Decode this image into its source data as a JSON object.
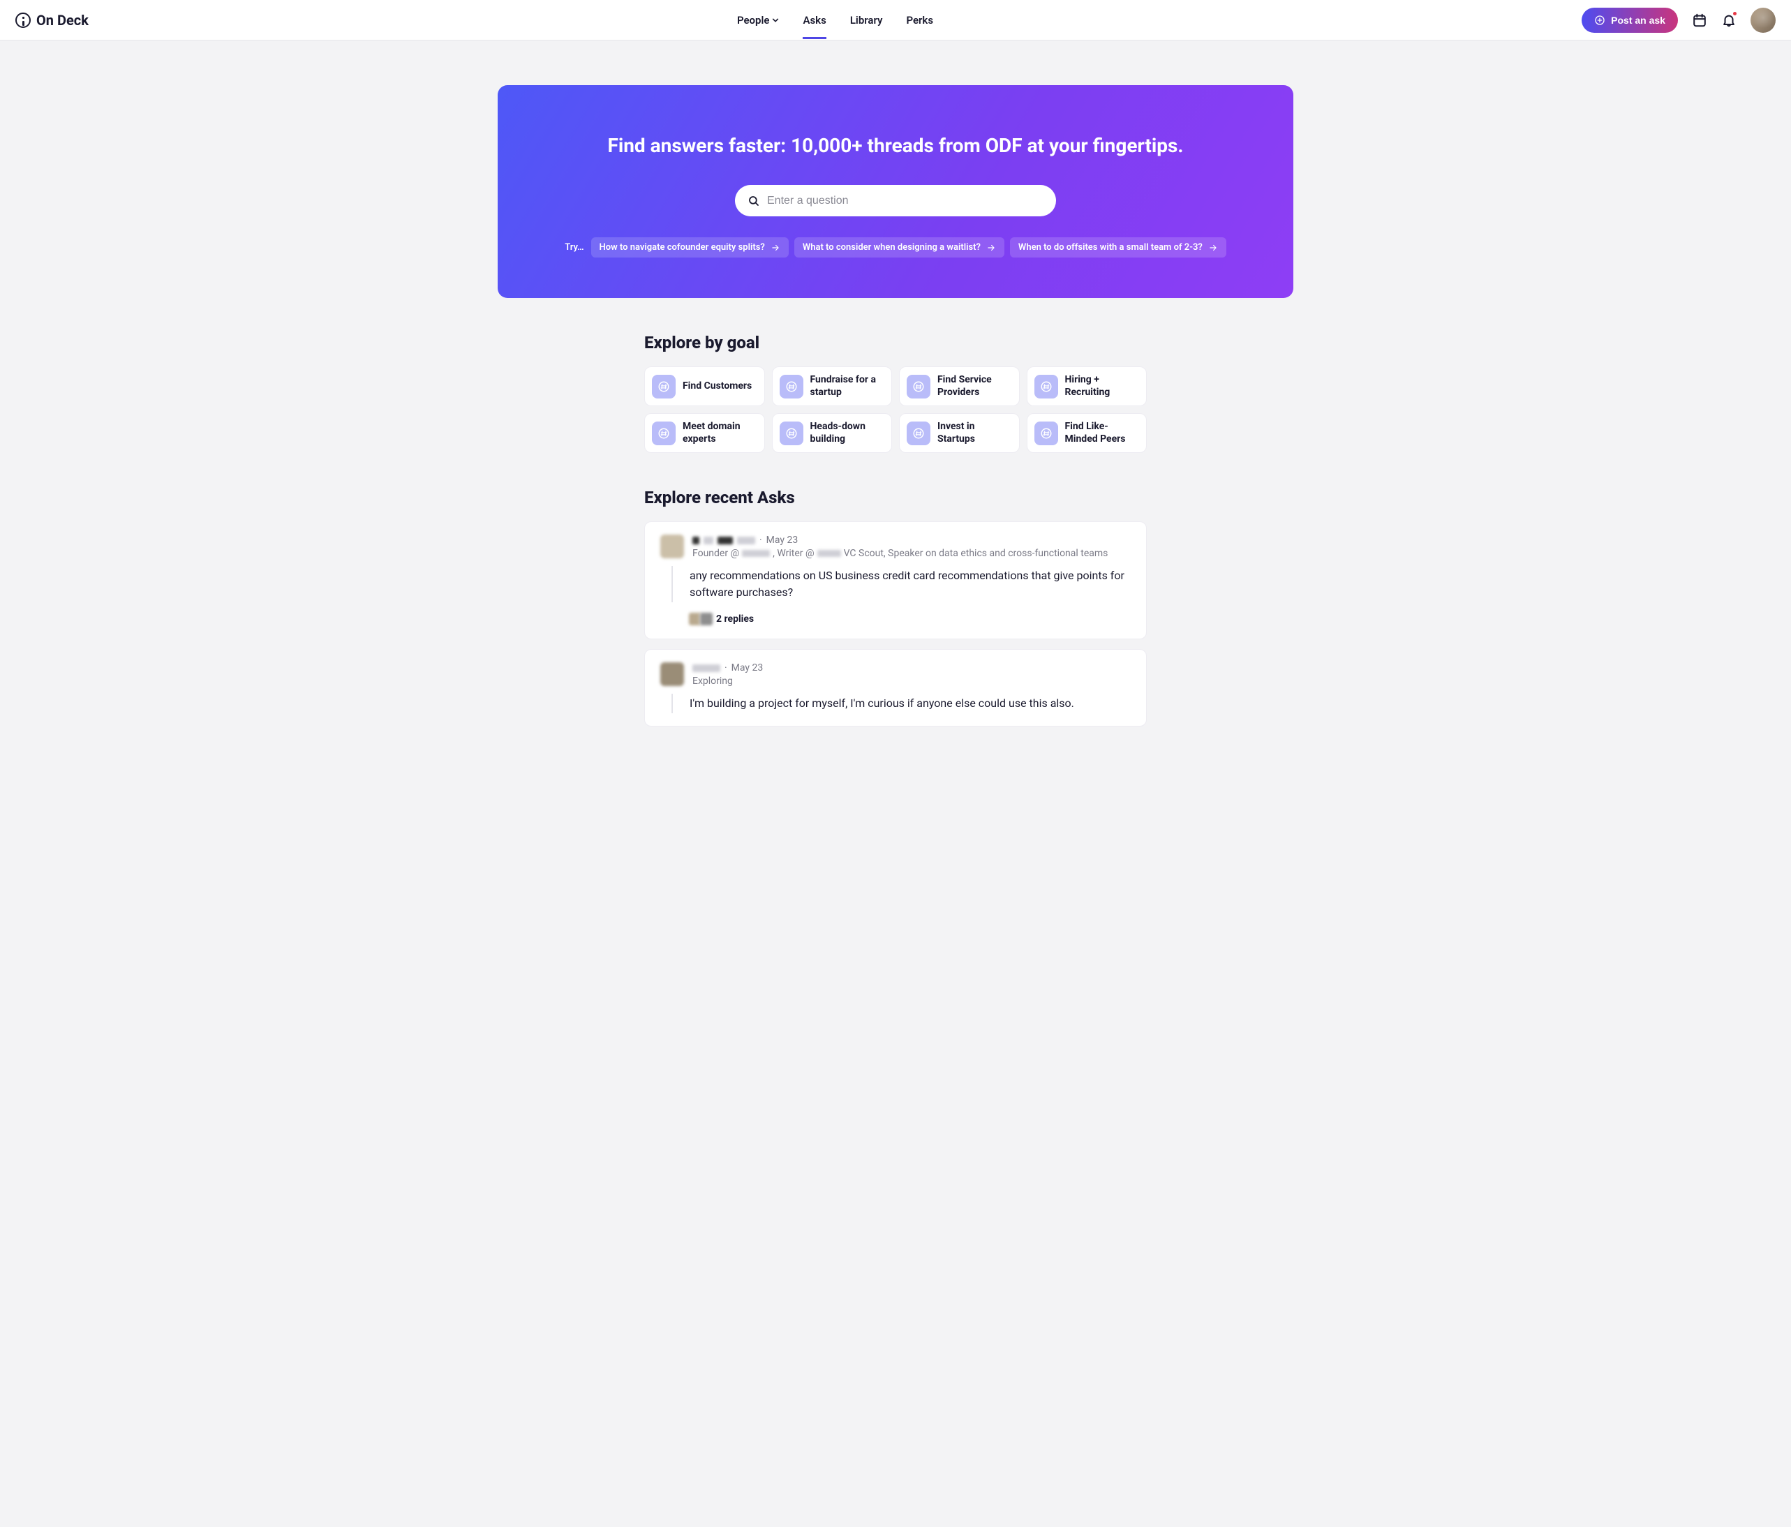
{
  "brand": "On Deck",
  "nav": {
    "people": "People",
    "asks": "Asks",
    "library": "Library",
    "perks": "Perks"
  },
  "post_ask": "Post an ask",
  "hero": {
    "title": "Find answers faster: 10,000+ threads from ODF at your fingertips.",
    "placeholder": "Enter a question",
    "try_label": "Try…",
    "chips": [
      "How to navigate cofounder equity splits?",
      "What to consider when designing a waitlist?",
      "When to do offsites with a small team of 2-3?"
    ]
  },
  "goals": {
    "heading": "Explore by goal",
    "items": [
      "Find Customers",
      "Fundraise for a startup",
      "Find Service Providers",
      "Hiring + Recruiting",
      "Meet domain experts",
      "Heads-down building",
      "Invest in Startups",
      "Find Like-Minded Peers"
    ]
  },
  "recent": {
    "heading": "Explore recent Asks",
    "asks": [
      {
        "date": "May 23",
        "subtitle_prefix": "Founder @ ",
        "subtitle_mid": ", Writer @ ",
        "subtitle_suffix": " VC Scout, Speaker on data ethics and cross-functional teams",
        "body": "any recommendations on US business credit card recommendations that give points for software purchases?",
        "replies": "2 replies"
      },
      {
        "date": "May 23",
        "subtitle": "Exploring",
        "body": "I'm building a project for myself, I'm curious if anyone else could use this also."
      }
    ]
  }
}
